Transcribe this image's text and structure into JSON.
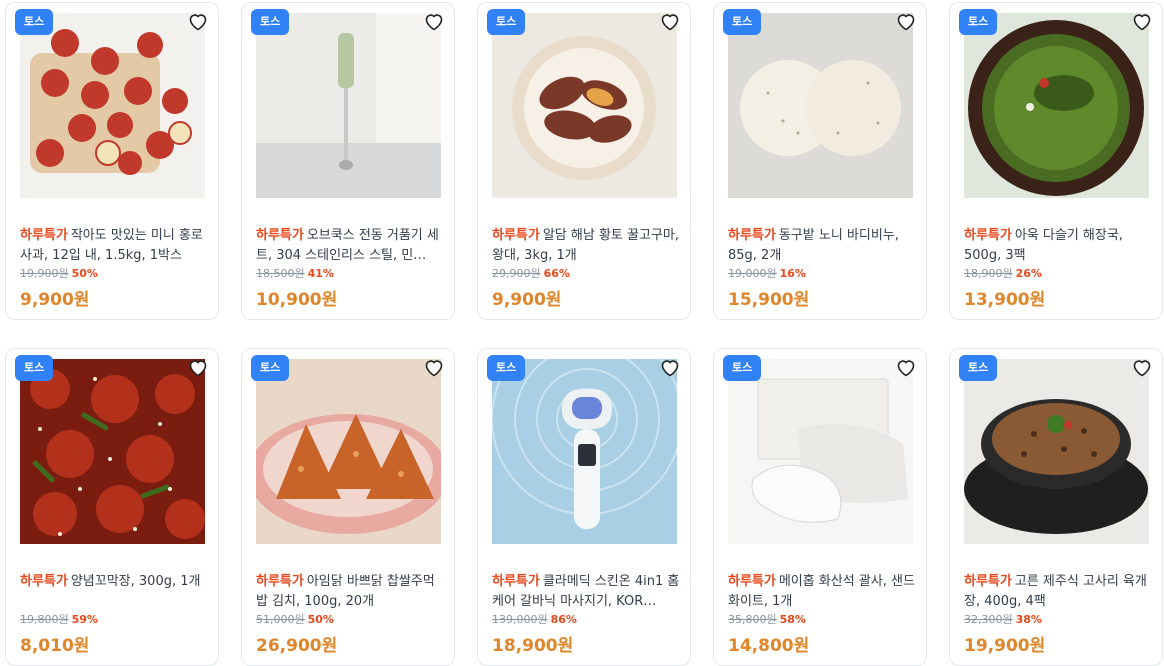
{
  "products": [
    {
      "badge": "토스",
      "tag": "하루특가",
      "name": "작아도 맛있는 미니 홍로사과, 12입 내, 1.5kg, 1박스",
      "original_price": "19,900원",
      "discount": "50%",
      "price": "9,900원"
    },
    {
      "badge": "토스",
      "tag": "하루특가",
      "name": "오브쿡스 전동 거품기 세트, 304 스테인리스 스틸, 민…",
      "original_price": "18,500원",
      "discount": "41%",
      "price": "10,900원"
    },
    {
      "badge": "토스",
      "tag": "하루특가",
      "name": "알담 해남 황토 꿀고구마, 왕대, 3kg, 1개",
      "original_price": "29,900원",
      "discount": "66%",
      "price": "9,900원"
    },
    {
      "badge": "토스",
      "tag": "하루특가",
      "name": "동구밭 노니 바디비누, 85g, 2개",
      "original_price": "19,000원",
      "discount": "16%",
      "price": "15,900원"
    },
    {
      "badge": "토스",
      "tag": "하루특가",
      "name": "아욱 다슬기 해장국, 500g, 3팩",
      "original_price": "18,900원",
      "discount": "26%",
      "price": "13,900원"
    },
    {
      "badge": "토스",
      "tag": "하루특가",
      "name": "양념꼬막장, 300g, 1개",
      "original_price": "19,800원",
      "discount": "59%",
      "price": "8,010원"
    },
    {
      "badge": "토스",
      "tag": "하루특가",
      "name": "아임닭 바쁘닭 찹쌀주먹밥 김치, 100g, 20개",
      "original_price": "51,000원",
      "discount": "50%",
      "price": "26,900원"
    },
    {
      "badge": "토스",
      "tag": "하루특가",
      "name": "클라메딕 스킨온 4in1 홈케어 갈바닉 마사지기, KOR…",
      "original_price": "139,000원",
      "discount": "86%",
      "price": "18,900원"
    },
    {
      "badge": "토스",
      "tag": "하루특가",
      "name": "메이홉 화산석 괄사, 샌드 화이트, 1개",
      "original_price": "35,800원",
      "discount": "58%",
      "price": "14,800원"
    },
    {
      "badge": "토스",
      "tag": "하루특가",
      "name": "고른 제주식 고사리 육개장, 400g, 4팩",
      "original_price": "32,300원",
      "discount": "38%",
      "price": "19,900원"
    }
  ]
}
